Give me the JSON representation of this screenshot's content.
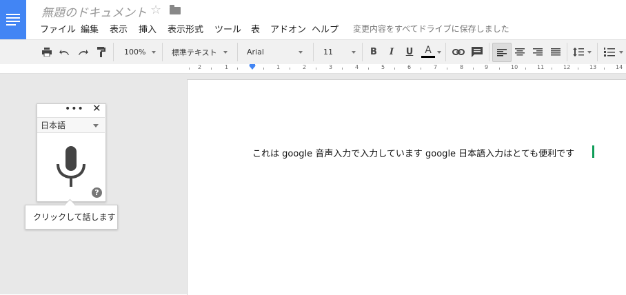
{
  "header": {
    "title": "無題のドキュメント",
    "save_status": "変更内容をすべてドライブに保存しました",
    "menu": [
      "ファイル",
      "編集",
      "表示",
      "挿入",
      "表示形式",
      "ツール",
      "表",
      "アドオン",
      "ヘルプ"
    ]
  },
  "toolbar": {
    "zoom": "100%",
    "style": "標準テキスト",
    "font": "Arial",
    "font_size": "11",
    "bold": "B",
    "italic": "I",
    "underline": "U",
    "text_color": "A"
  },
  "ruler": {
    "labels": [
      "2",
      "1",
      "1",
      "2",
      "3",
      "4",
      "5",
      "6",
      "7",
      "8",
      "9",
      "10",
      "11",
      "12",
      "13",
      "14"
    ]
  },
  "document": {
    "text": "これは google 音声入力で入力しています google 日本語入力はとても便利です"
  },
  "voice": {
    "language": "日本語",
    "help": "?",
    "tooltip": "クリックして話します"
  },
  "colors": {
    "brand": "#4285f4",
    "cursor": "#0f9d58"
  }
}
